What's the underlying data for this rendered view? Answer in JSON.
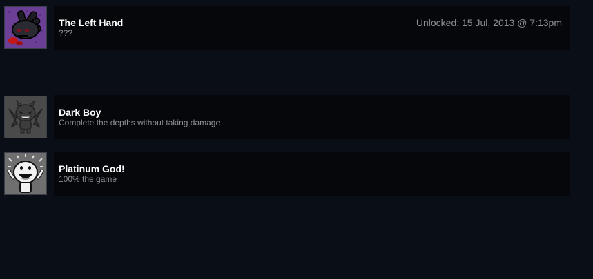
{
  "achievements": [
    {
      "icon": "left-hand-icon",
      "title": "The Left Hand",
      "description": "???",
      "unlock_text": "Unlocked: 15 Jul, 2013 @ 7:13pm",
      "unlocked": true
    },
    {
      "icon": "dark-boy-icon",
      "title": "Dark Boy",
      "description": "Complete the depths without taking damage",
      "unlocked": false
    },
    {
      "icon": "platinum-god-icon",
      "title": "Platinum God!",
      "description": "100% the game",
      "unlocked": false
    }
  ],
  "colors": {
    "background": "#0a0e16",
    "panel": "#05070b",
    "title": "#ffffff",
    "secondary_text": "#8c8f94",
    "unlocked_icon_bg": "#6a3f95"
  }
}
